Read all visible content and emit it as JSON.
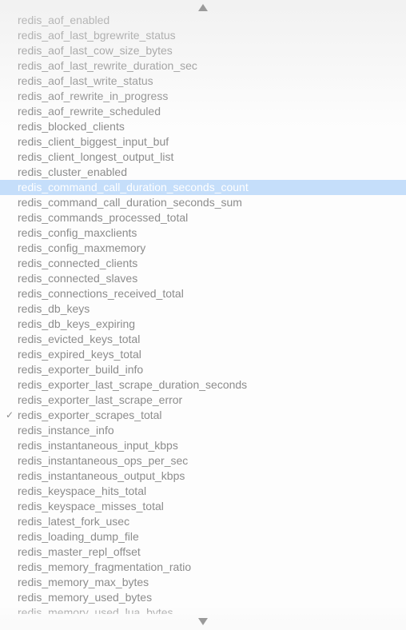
{
  "menu": {
    "scroll_up_icon": "triangle-up-icon",
    "scroll_down_icon": "triangle-down-icon",
    "check_icon": "checkmark-icon",
    "check_glyph": "✓",
    "selected_index": 11,
    "checked_index": 26,
    "colors": {
      "text": "#8c8c8c",
      "highlight_bg": "#c5defa",
      "highlight_text": "#ffffff",
      "arrow": "#9a9a9a"
    },
    "items": [
      "redis_aof_enabled",
      "redis_aof_last_bgrewrite_status",
      "redis_aof_last_cow_size_bytes",
      "redis_aof_last_rewrite_duration_sec",
      "redis_aof_last_write_status",
      "redis_aof_rewrite_in_progress",
      "redis_aof_rewrite_scheduled",
      "redis_blocked_clients",
      "redis_client_biggest_input_buf",
      "redis_client_longest_output_list",
      "redis_cluster_enabled",
      "redis_command_call_duration_seconds_count",
      "redis_command_call_duration_seconds_sum",
      "redis_commands_processed_total",
      "redis_config_maxclients",
      "redis_config_maxmemory",
      "redis_connected_clients",
      "redis_connected_slaves",
      "redis_connections_received_total",
      "redis_db_keys",
      "redis_db_keys_expiring",
      "redis_evicted_keys_total",
      "redis_expired_keys_total",
      "redis_exporter_build_info",
      "redis_exporter_last_scrape_duration_seconds",
      "redis_exporter_last_scrape_error",
      "redis_exporter_scrapes_total",
      "redis_instance_info",
      "redis_instantaneous_input_kbps",
      "redis_instantaneous_ops_per_sec",
      "redis_instantaneous_output_kbps",
      "redis_keyspace_hits_total",
      "redis_keyspace_misses_total",
      "redis_latest_fork_usec",
      "redis_loading_dump_file",
      "redis_master_repl_offset",
      "redis_memory_fragmentation_ratio",
      "redis_memory_max_bytes",
      "redis_memory_used_bytes",
      "redis_memory_used_lua_bytes"
    ]
  }
}
